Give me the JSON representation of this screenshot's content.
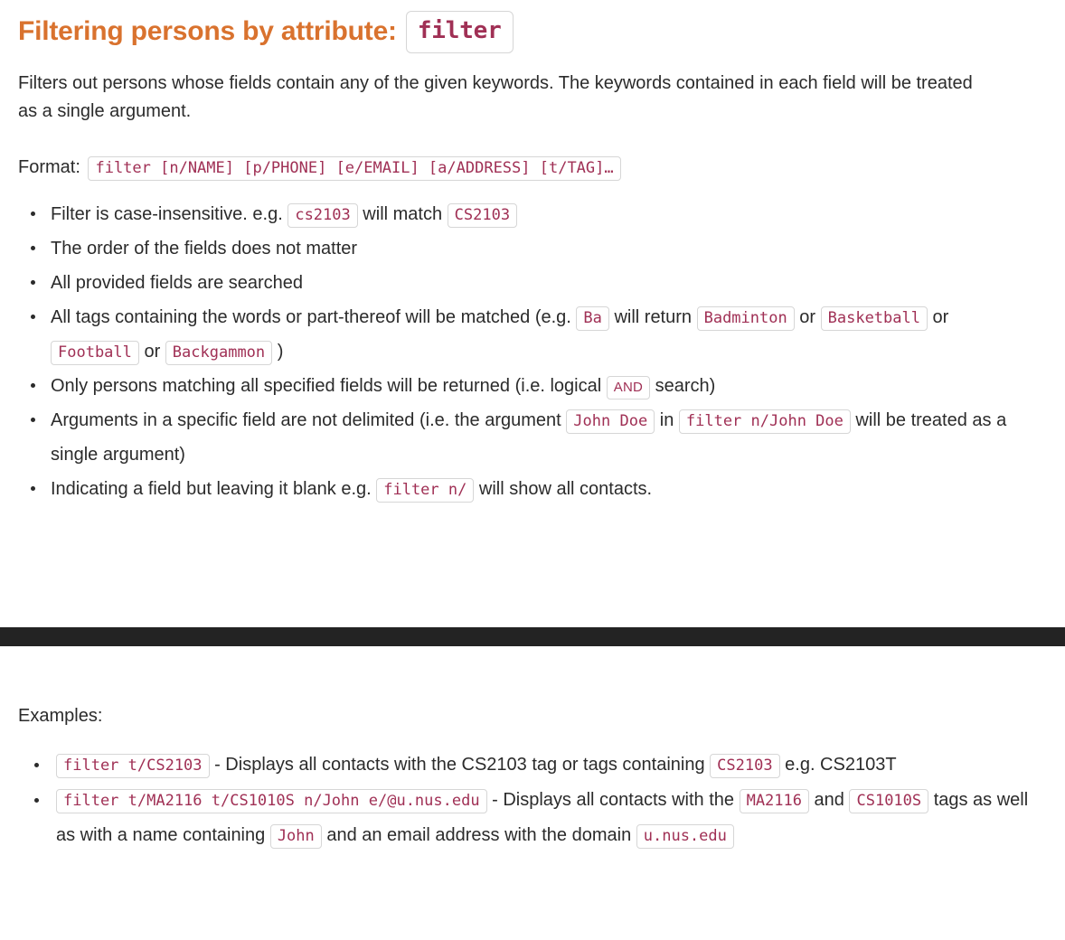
{
  "heading": {
    "text": "Filtering persons by attribute:",
    "command_badge": "filter",
    "color": "#d9722e"
  },
  "intro": {
    "paragraph": "Filters out persons whose fields contain any of the given keywords. The keywords contained in each field will be treated as a single argument."
  },
  "format": {
    "label": "Format:",
    "value": "filter [n/NAME] [p/PHONE] [e/EMAIL] [a/ADDRESS] [t/TAG]…"
  },
  "notes": [
    {
      "id": "case-insensitive",
      "parts": [
        {
          "type": "text",
          "value": "Filter is case-insensitive. e.g. "
        },
        {
          "type": "code",
          "value": "cs2103"
        },
        {
          "type": "text",
          "value": " will match "
        },
        {
          "type": "code",
          "value": "CS2103"
        }
      ]
    },
    {
      "id": "field-order",
      "parts": [
        {
          "type": "text",
          "value": "The order of the fields does not matter"
        }
      ]
    },
    {
      "id": "all-fields-searched",
      "parts": [
        {
          "type": "text",
          "value": "All provided fields are searched"
        }
      ]
    },
    {
      "id": "partial-tag-match",
      "parts": [
        {
          "type": "text",
          "value": "All tags containing the words or part-thereof will be matched (e.g. "
        },
        {
          "type": "code",
          "value": "Ba"
        },
        {
          "type": "text",
          "value": " will return "
        },
        {
          "type": "code",
          "value": "Badminton"
        },
        {
          "type": "text",
          "value": " or "
        },
        {
          "type": "code",
          "value": "Basketball"
        },
        {
          "type": "text",
          "value": " or "
        },
        {
          "type": "code",
          "value": "Football"
        },
        {
          "type": "text",
          "value": " or "
        },
        {
          "type": "code",
          "value": "Backgammon"
        },
        {
          "type": "text",
          "value": " )"
        }
      ]
    },
    {
      "id": "logical-and",
      "parts": [
        {
          "type": "text",
          "value": "Only persons matching all specified fields will be returned (i.e. logical "
        },
        {
          "type": "code-sans",
          "value": "AND"
        },
        {
          "type": "text",
          "value": " search)"
        }
      ]
    },
    {
      "id": "argument-not-delimited",
      "parts": [
        {
          "type": "text",
          "value": "Arguments in a specific field are not delimited (i.e. the argument "
        },
        {
          "type": "code",
          "value": "John Doe"
        },
        {
          "type": "text",
          "value": " in "
        },
        {
          "type": "code",
          "value": "filter n/John Doe"
        },
        {
          "type": "text",
          "value": " will be treated as a single argument)"
        }
      ]
    },
    {
      "id": "blank-field",
      "parts": [
        {
          "type": "text",
          "value": "Indicating a field but leaving it blank e.g. "
        },
        {
          "type": "code",
          "value": "filter n/"
        },
        {
          "type": "text",
          "value": " will show all contacts."
        }
      ]
    }
  ],
  "examples": {
    "label": "Examples:",
    "items": [
      {
        "id": "example-cs2103",
        "parts": [
          {
            "type": "code",
            "value": "filter t/CS2103"
          },
          {
            "type": "text",
            "value": " - Displays all contacts with the CS2103 tag or tags containing "
          },
          {
            "type": "code",
            "value": "CS2103"
          },
          {
            "type": "text",
            "value": " e.g. CS2103T"
          }
        ]
      },
      {
        "id": "example-multi-field",
        "parts": [
          {
            "type": "code",
            "value": "filter t/MA2116 t/CS1010S n/John e/@u.nus.edu"
          },
          {
            "type": "text",
            "value": " - Displays all contacts with the "
          },
          {
            "type": "code",
            "value": "MA2116"
          },
          {
            "type": "text",
            "value": " and "
          },
          {
            "type": "code",
            "value": "CS1010S"
          },
          {
            "type": "text",
            "value": " tags as well as with a name containing "
          },
          {
            "type": "code",
            "value": "John"
          },
          {
            "type": "text",
            "value": " and an email address with the domain "
          },
          {
            "type": "code",
            "value": "u.nus.edu"
          }
        ]
      }
    ]
  },
  "divider": {
    "color": "#232323"
  }
}
